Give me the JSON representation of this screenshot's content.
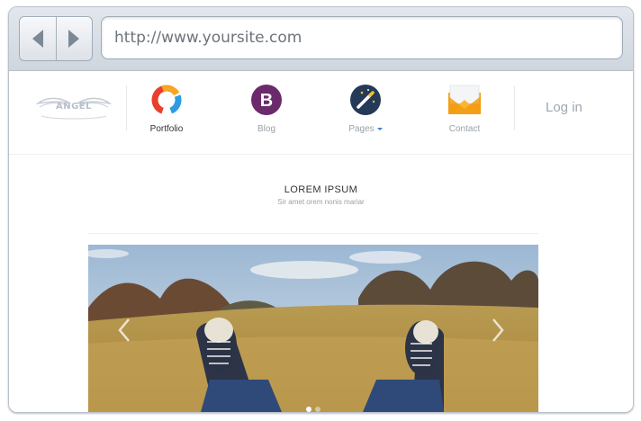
{
  "browser": {
    "url": "http://www.yoursite.com",
    "back_icon": "back-arrow-icon",
    "forward_icon": "forward-arrow-icon"
  },
  "site": {
    "logo_text": "ANGEL",
    "nav": [
      {
        "label": "Portfolio",
        "icon": "portfolio-icon",
        "active": true
      },
      {
        "label": "Blog",
        "icon": "blog-icon",
        "active": false
      },
      {
        "label": "Pages",
        "icon": "pages-icon",
        "active": false,
        "dropdown": true
      },
      {
        "label": "Contact",
        "icon": "contact-icon",
        "active": false
      }
    ],
    "login_label": "Log in",
    "intro": {
      "title": "LOREM IPSUM",
      "subtitle": "Sir amet orem nonis mariar"
    },
    "slider": {
      "slide_count": 2,
      "active_slide": 1
    }
  },
  "colors": {
    "blog_purple": "#6b2a6b",
    "pages_navy": "#243a58",
    "contact_orange": "#f2a21b",
    "accent_blue": "#3b7dd8"
  }
}
